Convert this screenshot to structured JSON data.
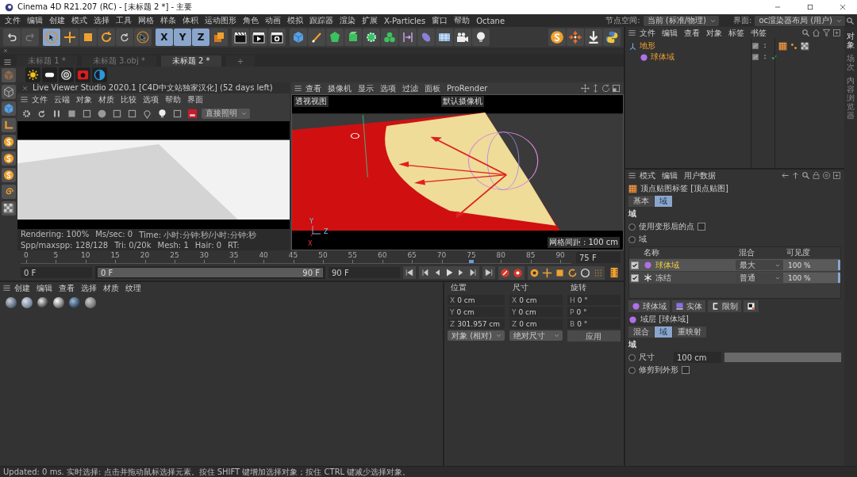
{
  "window": {
    "title": "Cinema 4D R21.207 (RC) - [未标题 2 *] - 主要"
  },
  "menu_bar": [
    "文件",
    "编辑",
    "创建",
    "模式",
    "选择",
    "工具",
    "网格",
    "样条",
    "体积",
    "运动图形",
    "角色",
    "动画",
    "模拟",
    "跟踪器",
    "渲染",
    "扩展",
    "X-Particles",
    "窗口",
    "帮助",
    "Octane"
  ],
  "node_space": {
    "label": "节点空间:",
    "value": "当前 (标准/物理)"
  },
  "layout": {
    "label": "界面:",
    "value": "oc渲染器布局 (用户)"
  },
  "axis_buttons": [
    {
      "label": "X",
      "selected": true
    },
    {
      "label": "Y",
      "selected": true
    },
    {
      "label": "Z",
      "selected": true
    }
  ],
  "doc_tabs": [
    {
      "label": "未标题 1 *",
      "selected": false
    },
    {
      "label": "未标题 3.obj *",
      "selected": false
    },
    {
      "label": "未标题 2 *",
      "selected": true
    }
  ],
  "new_tab": "+",
  "live_viewer": {
    "title": "Live Viewer Studio 2020.1 [C4D中文站独家汉化] (52 days left)",
    "menu": [
      "文件",
      "云端",
      "对象",
      "材质",
      "比较",
      "选项",
      "帮助",
      "界面"
    ],
    "mode": "直接照明",
    "status": [
      "Rendering: 100%",
      "Ms/sec: 0",
      "Time: 小时:分钟:秒/小时:分钟:秒",
      "Spp/maxspp: 128/128",
      "Tri: 0/20k",
      "Mesh: 1",
      "Hair: 0",
      "RT:"
    ]
  },
  "viewport": {
    "menu": [
      "查看",
      "摄像机",
      "显示",
      "选项",
      "过滤",
      "面板",
      "ProRender"
    ],
    "view_name": "透视视图",
    "camera": "默认摄像机",
    "grid": "网格间距 : 100 cm",
    "axis_labels": [
      "Y",
      "Z",
      "X"
    ]
  },
  "timeline": {
    "ticks": [
      "0",
      "5",
      "10",
      "15",
      "20",
      "25",
      "30",
      "35",
      "40",
      "45",
      "50",
      "55",
      "60",
      "65",
      "70",
      "75",
      "80",
      "85",
      "90"
    ],
    "current": "75 F",
    "playhead": {
      "level": 0.833
    }
  },
  "playback": {
    "start": "0 F",
    "range": {
      "start": "0 F",
      "end": "90 F",
      "level": 1
    },
    "end": "90 F"
  },
  "material_manager": {
    "menu": [
      "创建",
      "编辑",
      "查看",
      "选择",
      "材质",
      "纹理"
    ]
  },
  "coordinates": {
    "headers": [
      "位置",
      "尺寸",
      "旋转"
    ],
    "rows": [
      {
        "position_axis": "X",
        "position": "0 cm",
        "size_axis": "X",
        "size": "0 cm",
        "rotation_axis": "H",
        "rotation": "0 °"
      },
      {
        "position_axis": "Y",
        "position": "0 cm",
        "size_axis": "Y",
        "size": "0 cm",
        "rotation_axis": "P",
        "rotation": "0 °"
      },
      {
        "position_axis": "Z",
        "position": "301.957 cm",
        "size_axis": "Z",
        "size": "0 cm",
        "rotation_axis": "B",
        "rotation": "0 °"
      }
    ],
    "mode": "对象 (相对)",
    "size_mode": "绝对尺寸",
    "apply": "应用"
  },
  "object_manager": {
    "menu": [
      "文件",
      "编辑",
      "查看",
      "对象",
      "标签",
      "书签"
    ],
    "objects": [
      {
        "name": "地形",
        "kind": "null",
        "selected": true,
        "children": [
          {
            "name": "球体域",
            "kind": "sphere_field",
            "selected": true,
            "enabled": true
          }
        ]
      }
    ]
  },
  "side_tabs": [
    "对象",
    "场次",
    "内容浏览器"
  ],
  "attributes": {
    "menu": [
      "模式",
      "编辑",
      "用户数据"
    ],
    "title": "顶点贴图标签 [顶点贴图]",
    "tabs": [
      {
        "label": "基本",
        "selected": false
      },
      {
        "label": "域",
        "selected": true
      }
    ],
    "section": "域",
    "options": [
      {
        "kind": "checkbox",
        "label": "使用变形后的点",
        "checked": false
      },
      {
        "kind": "text",
        "label": "域"
      }
    ],
    "fields_table": {
      "columns": [
        "名称",
        "混合",
        "可见度"
      ],
      "rows": [
        {
          "kind": "sphere_field",
          "checked": true,
          "name": "球体域",
          "blend": "最大",
          "visibility": "100 %",
          "selected": true
        },
        {
          "kind": "freeze",
          "checked": true,
          "name": "冻结",
          "blend": "普通",
          "visibility": "100 %",
          "selected": false
        }
      ]
    },
    "add_buttons": [
      {
        "kind": "sphere_field",
        "label": "球体域"
      },
      {
        "kind": "solid",
        "label": "实体"
      },
      {
        "kind": "clamp",
        "label": "限制"
      }
    ],
    "layer_title": "域层 [球体域]",
    "layer_tabs": [
      {
        "label": "混合",
        "selected": false
      },
      {
        "label": "域",
        "selected": true
      },
      {
        "label": "重映射",
        "selected": false
      }
    ],
    "layer_section": "域",
    "size": {
      "label": "尺寸",
      "value": "100 cm",
      "level": 1
    },
    "clip": {
      "label": "修剪到外形",
      "checked": false
    }
  },
  "status_bar": "Updated: 0 ms.   实时选择: 点击并拖动鼠标选择元素。按住 SHIFT 键增加选择对象；按住 CTRL 键减少选择对象。"
}
